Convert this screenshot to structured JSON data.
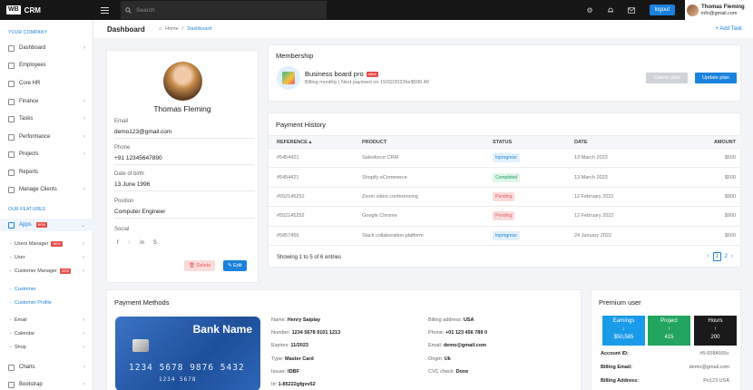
{
  "app": {
    "logo": "WB",
    "name": "CRM"
  },
  "topbar": {
    "search_placeholder": "Search",
    "logout": "logout",
    "user_name": "Thomas Fleming",
    "user_email": "info@gmail.com"
  },
  "sidebar": {
    "section1": "YOUR COMPANY",
    "items": [
      {
        "label": "Dashboard"
      },
      {
        "label": "Employees"
      },
      {
        "label": "Core HR"
      },
      {
        "label": "Finance"
      },
      {
        "label": "Tasks"
      },
      {
        "label": "Performance"
      },
      {
        "label": "Projects"
      },
      {
        "label": "Reports"
      },
      {
        "label": "Manage Clients"
      }
    ],
    "section2": "OUR FEATURES",
    "apps": {
      "label": "Apps",
      "badge": "NEW"
    },
    "subs": [
      {
        "label": "Users Manager",
        "badge": "NEW"
      },
      {
        "label": "User"
      },
      {
        "label": "Customer Manager",
        "badge": "NEW"
      },
      {
        "label": "Customer"
      },
      {
        "label": "Customer Profile"
      }
    ],
    "more": [
      {
        "label": "Email"
      },
      {
        "label": "Calendar"
      },
      {
        "label": "Shop"
      }
    ],
    "bottom": [
      {
        "label": "Charts"
      },
      {
        "label": "Bootstrap"
      }
    ]
  },
  "header": {
    "title": "Dashboard",
    "crumb_home": "Home",
    "crumb_sep": "/",
    "crumb_current": "Dashboard",
    "add_task": "+ Add Task"
  },
  "profile": {
    "name": "Thomas Fleming",
    "email_label": "Email",
    "email": "demo123@gmail.com",
    "phone_label": "Phone",
    "phone": "+91 12345647890",
    "dob_label": "Date of birth",
    "dob": "13 June 1996",
    "position_label": "Position",
    "position": "Computer Engineer",
    "social_label": "Social",
    "delete": "Delete",
    "edit": "Edit"
  },
  "membership": {
    "title": "Membership",
    "plan": "Business board pro",
    "badge": "active",
    "details": "Billing monthly | Next payment on 15/02/2023for$590.40",
    "cancel": "Cancle plan",
    "update": "Update plan"
  },
  "payment_history": {
    "title": "Payment History",
    "headers": [
      "REFERENCE",
      "PRODUCT",
      "STATUS",
      "DATE",
      "AMOUNT"
    ],
    "rows": [
      {
        "ref": "#5454421",
        "product": "Salesforce CRM",
        "status": "Inprogress",
        "date": "13 March 2023",
        "amount": "$500"
      },
      {
        "ref": "#5454421",
        "product": "Shopify eCommerce",
        "status": "Completed",
        "date": "13 March 2023",
        "amount": "$500"
      },
      {
        "ref": "#552145252",
        "product": "Zoom video conferencing",
        "status": "Pending",
        "date": "12 February 2022",
        "amount": "$900"
      },
      {
        "ref": "#552145252",
        "product": "Google Chrome",
        "status": "Pending",
        "date": "12 February 2022",
        "amount": "$900"
      },
      {
        "ref": "#5857455",
        "product": "Slack collaboration platform",
        "status": "Inprogress",
        "date": "24 January 2022",
        "amount": "$600"
      }
    ],
    "footer": "Showing 1 to 5 of 6 entries",
    "pages": [
      "1",
      "2"
    ]
  },
  "payment_methods": {
    "title": "Payment Methods",
    "card": {
      "bank": "Bank Name",
      "number": "1234 5678 9876 5432",
      "small_number": "1234 5678"
    },
    "left": [
      {
        "k": "Name:",
        "v": "Henry Saiplay"
      },
      {
        "k": "Number:",
        "v": "1234 5678 9101 1213"
      },
      {
        "k": "Expires:",
        "v": "11/2023"
      },
      {
        "k": "Type:",
        "v": "Master Card"
      },
      {
        "k": "Issuer:",
        "v": "IDBF"
      },
      {
        "k": "Id:",
        "v": "1-85222gfgvv52"
      }
    ],
    "right": [
      {
        "k": "Billing address:",
        "v": "USA"
      },
      {
        "k": "Phone:",
        "v": "+01 123 456 789 0"
      },
      {
        "k": "Email:",
        "v": "demo@gmail.com"
      },
      {
        "k": "Origin:",
        "v": "Uk"
      },
      {
        "k": "CVC check:",
        "v": "Done"
      }
    ]
  },
  "premium": {
    "title": "Premium user",
    "stats": [
      {
        "label": "Earnings",
        "arrow": "↓",
        "value": "$50,585",
        "color": "#1a9bea"
      },
      {
        "label": "Project",
        "arrow": "↑",
        "value": "415",
        "color": "#22a55e"
      },
      {
        "label": "Hours",
        "arrow": "↑",
        "value": "200",
        "color": "#1a1a1a"
      }
    ],
    "rows": [
      {
        "k": "Account ID:",
        "v": "#5-658A555c"
      },
      {
        "k": "Billing Email:",
        "v": "demo@gmail.com"
      },
      {
        "k": "Billing Address:",
        "v": "Po123 USA"
      }
    ]
  }
}
